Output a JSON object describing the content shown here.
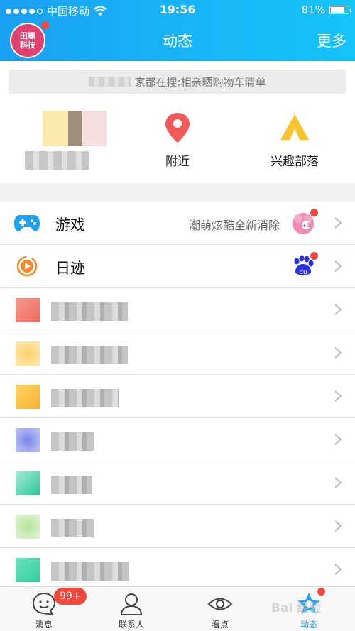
{
  "status_bar": {
    "carrier": "中国移动",
    "time": "19:56",
    "battery": "81%",
    "battery_level": 0.81
  },
  "header": {
    "avatar_text": "田螺\n科技",
    "title": "动态",
    "more": "更多"
  },
  "search": {
    "text": "家都在搜:相亲晒购物车清单"
  },
  "quick_actions": [
    {
      "label": ""
    },
    {
      "label": "附近",
      "icon": "location-pin-icon"
    },
    {
      "label": "兴趣部落",
      "icon": "tent-icon"
    }
  ],
  "rows": [
    {
      "label": "游戏",
      "subtitle": "潮萌炫酷全新消除",
      "icon": "gamepad-icon",
      "badge": "game-thumbnail",
      "has_dot": true
    },
    {
      "label": "日迹",
      "subtitle": "",
      "icon": "play-circle-icon",
      "badge": "baidu-paw-icon",
      "has_dot": true
    }
  ],
  "tabs": [
    {
      "label": "消息",
      "icon": "message-icon"
    },
    {
      "label": "联系人",
      "icon": "contacts-icon"
    },
    {
      "label": "看点",
      "icon": "eye-icon"
    },
    {
      "label": "动态",
      "icon": "star-icon"
    }
  ],
  "message_badge": "99+",
  "watermark": "Bai 经验",
  "colors": {
    "accent": "#1da1f2",
    "badge": "#f4473b"
  }
}
